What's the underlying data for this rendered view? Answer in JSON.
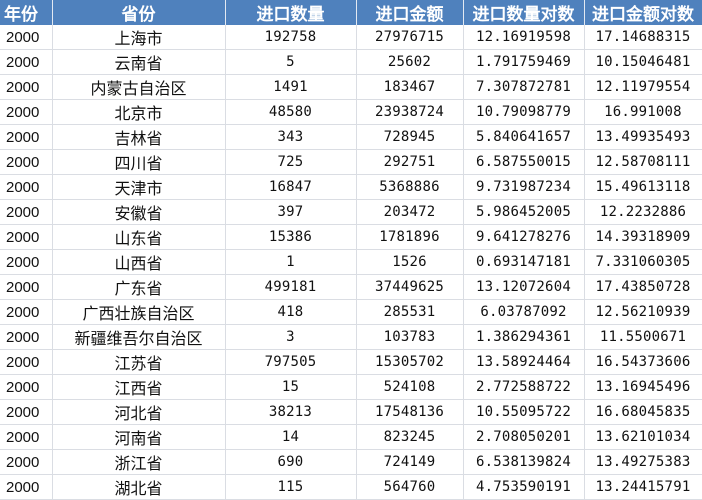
{
  "headers": [
    "年份",
    "省份",
    "进口数量",
    "进口金额",
    "进口数量对数",
    "进口金额对数"
  ],
  "rows": [
    [
      "2000",
      "上海市",
      "192758",
      "27976715",
      "12.16919598",
      "17.14688315"
    ],
    [
      "2000",
      "云南省",
      "5",
      "25602",
      "1.791759469",
      "10.15046481"
    ],
    [
      "2000",
      "内蒙古自治区",
      "1491",
      "183467",
      "7.307872781",
      "12.11979554"
    ],
    [
      "2000",
      "北京市",
      "48580",
      "23938724",
      "10.79098779",
      "16.991008"
    ],
    [
      "2000",
      "吉林省",
      "343",
      "728945",
      "5.840641657",
      "13.49935493"
    ],
    [
      "2000",
      "四川省",
      "725",
      "292751",
      "6.587550015",
      "12.58708111"
    ],
    [
      "2000",
      "天津市",
      "16847",
      "5368886",
      "9.731987234",
      "15.49613118"
    ],
    [
      "2000",
      "安徽省",
      "397",
      "203472",
      "5.986452005",
      "12.2232886"
    ],
    [
      "2000",
      "山东省",
      "15386",
      "1781896",
      "9.641278276",
      "14.39318909"
    ],
    [
      "2000",
      "山西省",
      "1",
      "1526",
      "0.693147181",
      "7.331060305"
    ],
    [
      "2000",
      "广东省",
      "499181",
      "37449625",
      "13.12072604",
      "17.43850728"
    ],
    [
      "2000",
      "广西壮族自治区",
      "418",
      "285531",
      "6.03787092",
      "12.56210939"
    ],
    [
      "2000",
      "新疆维吾尔自治区",
      "3",
      "103783",
      "1.386294361",
      "11.5500671"
    ],
    [
      "2000",
      "江苏省",
      "797505",
      "15305702",
      "13.58924464",
      "16.54373606"
    ],
    [
      "2000",
      "江西省",
      "15",
      "524108",
      "2.772588722",
      "13.16945496"
    ],
    [
      "2000",
      "河北省",
      "38213",
      "17548136",
      "10.55095722",
      "16.68045835"
    ],
    [
      "2000",
      "河南省",
      "14",
      "823245",
      "2.708050201",
      "13.62101034"
    ],
    [
      "2000",
      "浙江省",
      "690",
      "724149",
      "6.538139824",
      "13.49275383"
    ],
    [
      "2000",
      "湖北省",
      "115",
      "564760",
      "4.753590191",
      "13.24415791"
    ]
  ],
  "colors": {
    "header_bg": "#4f81bd",
    "header_text": "#ffffff",
    "grid": "#dadde3"
  }
}
